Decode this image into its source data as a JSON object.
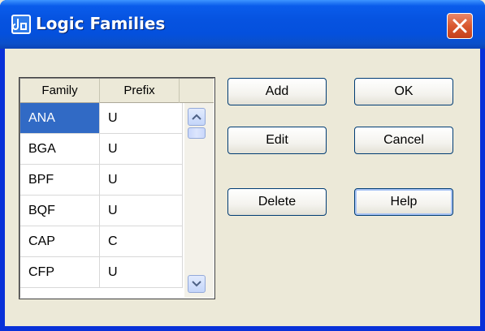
{
  "window": {
    "title": "Logic Families",
    "icons": {
      "app": "app-icon",
      "close": "close-icon"
    }
  },
  "list": {
    "columns": [
      "Family",
      "Prefix"
    ],
    "rows": [
      {
        "family": "ANA",
        "prefix": "U",
        "selected": true
      },
      {
        "family": "BGA",
        "prefix": "U"
      },
      {
        "family": "BPF",
        "prefix": "U"
      },
      {
        "family": "BQF",
        "prefix": "U"
      },
      {
        "family": "CAP",
        "prefix": "C"
      },
      {
        "family": "CFP",
        "prefix": "U"
      }
    ]
  },
  "buttons": {
    "add": "Add",
    "edit": "Edit",
    "delete": "Delete",
    "ok": "OK",
    "cancel": "Cancel",
    "help": "Help"
  },
  "colors": {
    "titlebar": "#0A5CEB",
    "selection": "#316AC5",
    "close": "#D9582F",
    "dialog_bg": "#ECE9D8"
  }
}
